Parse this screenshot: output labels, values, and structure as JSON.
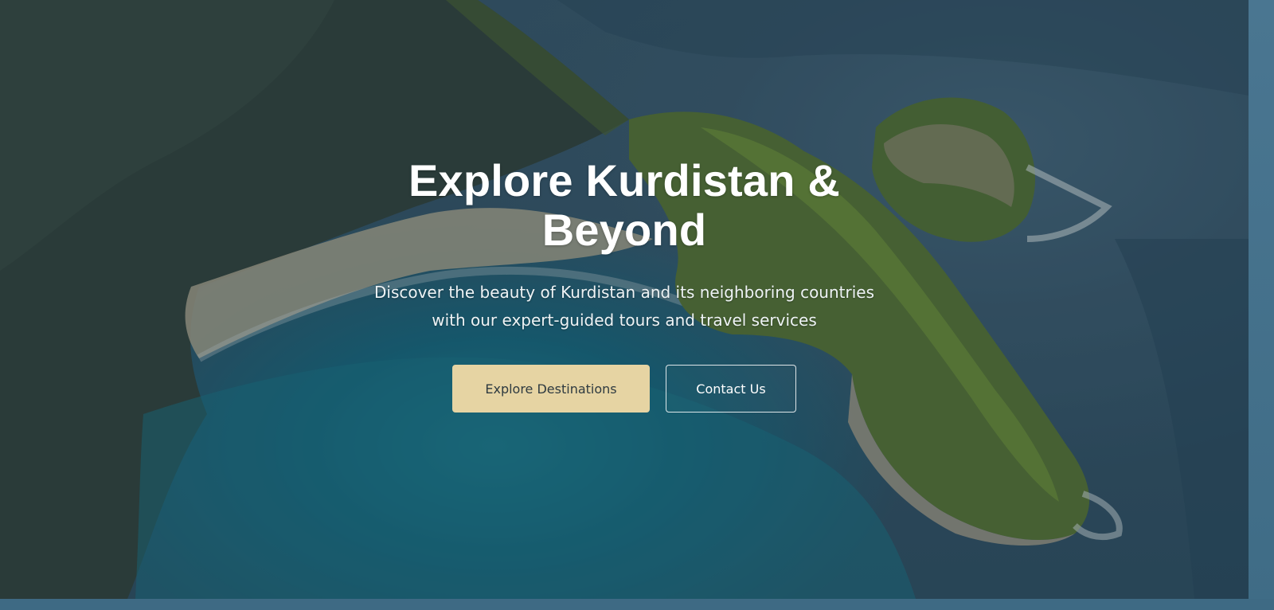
{
  "hero": {
    "title": "Explore Kurdistan & Beyond",
    "subtitle": "Discover the beauty of Kurdistan and its neighboring countries with our expert-guided tours and travel services",
    "primary_button": "Explore Destinations",
    "secondary_button": "Contact Us"
  },
  "colors": {
    "accent": "#e6d4a3",
    "ocean": "#1f8ea3",
    "cliff_green": "#6e9a3c"
  }
}
